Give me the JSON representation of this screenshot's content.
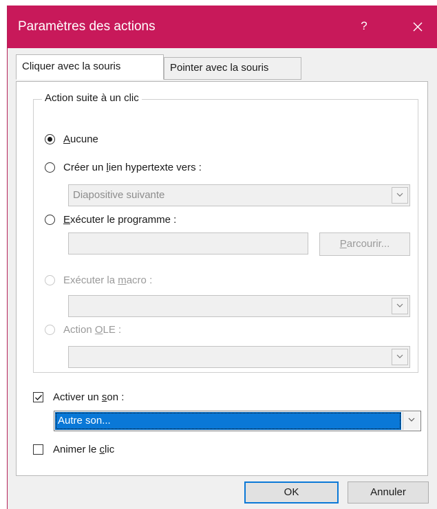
{
  "window": {
    "title": "Paramètres des actions",
    "help_label": "?",
    "accent_color": "#c8195a",
    "selection_color": "#0a78d7"
  },
  "tabs": [
    {
      "label": "Cliquer avec la souris",
      "active": true
    },
    {
      "label": "Pointer avec la souris",
      "active": false
    }
  ],
  "action_group": {
    "legend": "Action suite à un clic",
    "options": [
      {
        "pre": "",
        "key": "A",
        "post": "ucune",
        "checked": true,
        "enabled": true
      },
      {
        "pre": "Créer un ",
        "key": "l",
        "post": "ien hypertexte vers :",
        "checked": false,
        "enabled": true
      },
      {
        "pre": "",
        "key": "E",
        "post": "xécuter le programme :",
        "checked": false,
        "enabled": true
      },
      {
        "pre": "Exécuter la ",
        "key": "m",
        "post": "acro :",
        "checked": false,
        "enabled": false
      },
      {
        "pre": "Action ",
        "key": "O",
        "post": "LE :",
        "checked": false,
        "enabled": false
      }
    ],
    "hyperlink_value": "Diapositive suivante",
    "program_value": "",
    "browse": {
      "key": "P",
      "rest": "arcourir..."
    },
    "macro_value": "",
    "ole_value": ""
  },
  "sound": {
    "checkbox": {
      "pre": "Activer un ",
      "key": "s",
      "post": "on :",
      "checked": true
    },
    "selected_value": "Autre son..."
  },
  "animate": {
    "pre": "Animer le ",
    "key": "c",
    "post": "lic",
    "checked": false
  },
  "buttons": {
    "ok": "OK",
    "cancel": "Annuler"
  },
  "icons": [
    "close-icon",
    "chevron-down-icon",
    "checkmark-icon"
  ]
}
